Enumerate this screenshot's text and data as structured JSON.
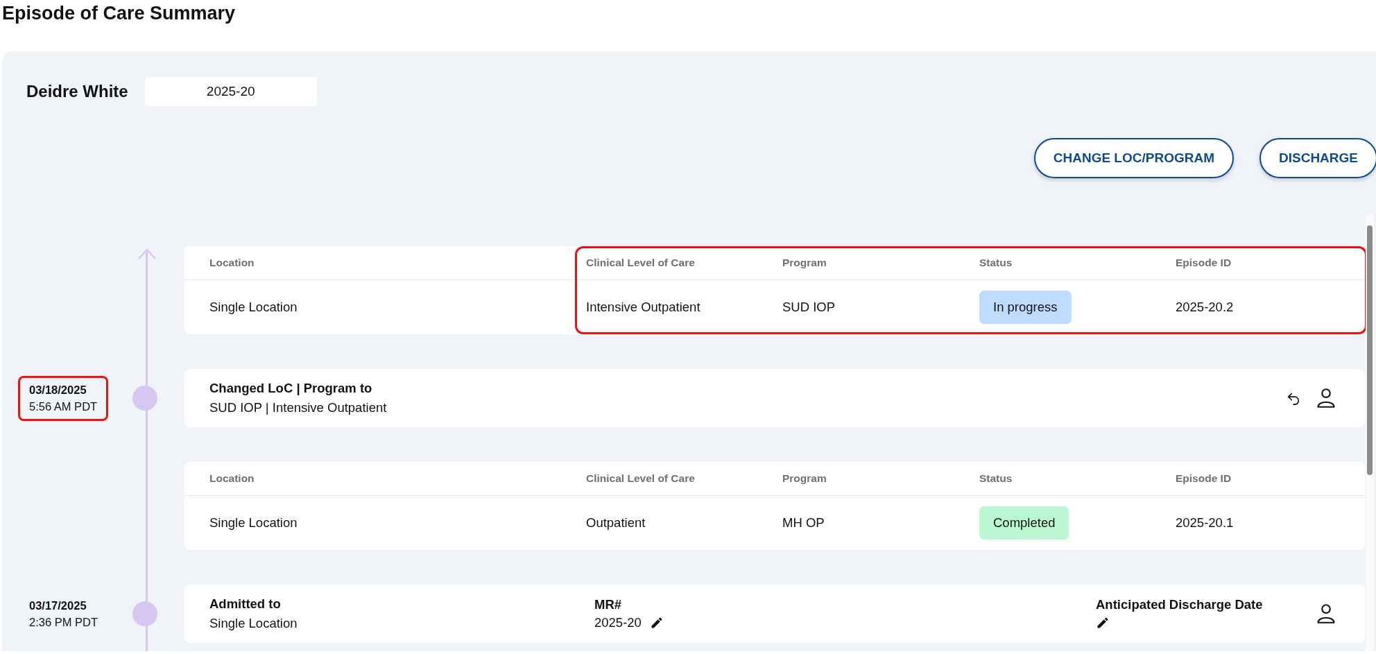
{
  "title": "Episode of Care Summary",
  "patient": {
    "name": "Deidre White",
    "episode_number": "2025-20"
  },
  "actions": [
    "CHANGE LOC/PROGRAM",
    "DISCHARGE"
  ],
  "timeline": [
    {
      "kind": "episode_table",
      "highlighted": true,
      "columns": [
        "Location",
        "Clinical Level of Care",
        "Program",
        "Status",
        "Episode ID"
      ],
      "cells": [
        {
          "kind": "text",
          "text": "Single Location"
        },
        {
          "kind": "text",
          "text": "Intensive Outpatient"
        },
        {
          "kind": "text",
          "text": "SUD IOP"
        },
        {
          "kind": "status",
          "text": "In progress",
          "color": "#bfdbfe"
        },
        {
          "kind": "text",
          "text": "2025-20.2"
        }
      ]
    },
    {
      "kind": "event",
      "date": "03/18/2025",
      "time": "5:56 AM PDT",
      "date_highlighted": true,
      "title": "Changed LoC | Program to",
      "detail": "SUD IOP | Intensive Outpatient",
      "undoable": true
    },
    {
      "kind": "episode_table",
      "highlighted": false,
      "columns": [
        "Location",
        "Clinical Level of Care",
        "Program",
        "Status",
        "Episode ID"
      ],
      "cells": [
        {
          "kind": "text",
          "text": "Single Location"
        },
        {
          "kind": "text",
          "text": "Outpatient"
        },
        {
          "kind": "text",
          "text": "MH OP"
        },
        {
          "kind": "status",
          "text": "Completed",
          "color": "#bbf7d0"
        },
        {
          "kind": "text",
          "text": "2025-20.1"
        }
      ]
    },
    {
      "kind": "event",
      "date": "03/17/2025",
      "time": "2:36 PM PDT",
      "date_highlighted": false,
      "title": "Admitted to",
      "detail": "Single Location",
      "undoable": false,
      "fields": [
        {
          "label": "MR#",
          "value": "2025-20",
          "editable": true
        },
        {
          "label": "Anticipated Discharge Date",
          "editable": true
        }
      ]
    }
  ]
}
